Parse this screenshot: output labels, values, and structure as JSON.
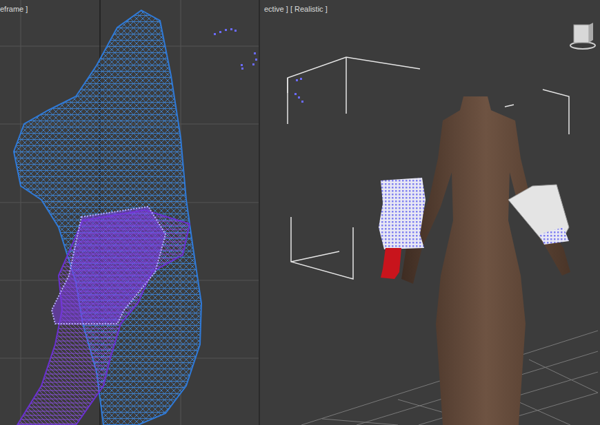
{
  "viewports": [
    {
      "label": "eframe ]",
      "kind": "wireframe"
    },
    {
      "label": "ective ] [ Realistic ]",
      "kind": "shaded"
    }
  ]
}
